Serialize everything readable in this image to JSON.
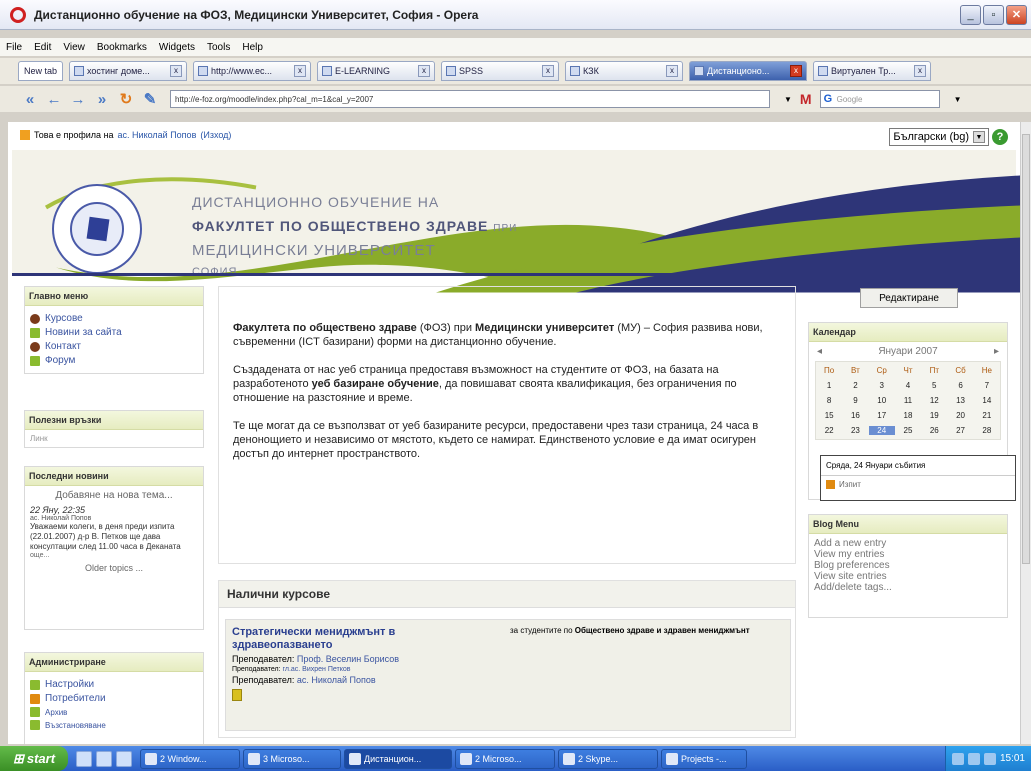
{
  "window": {
    "title": "Дистанционно обучение на ФОЗ, Медицински Университет, София - Opera",
    "min": "_",
    "max": "▫",
    "close": "✕"
  },
  "menu": [
    "File",
    "Edit",
    "View",
    "Bookmarks",
    "Widgets",
    "Tools",
    "Help"
  ],
  "tabs": {
    "new": "New tab",
    "items": [
      {
        "label": "хостинг доме..."
      },
      {
        "label": "http://www.ec..."
      },
      {
        "label": "E-LEARNING"
      },
      {
        "label": "SPSS"
      },
      {
        "label": "КЗК"
      },
      {
        "label": "Дистанционо...",
        "active": true
      },
      {
        "label": "Виртуален Тр..."
      }
    ]
  },
  "address": {
    "url": "http://e-foz.org/moodle/index.php?cal_m=1&cal_y=2007",
    "search_placeholder": "Google"
  },
  "page": {
    "login_prefix": "Това е профила на",
    "login_user": "ас. Николай Попов",
    "login_exit": "(Изход)",
    "language": "Български (bg)",
    "banner": {
      "l1": "ДИСТАНЦИОННО ОБУЧЕНИЕ НА",
      "l2": "ФАКУЛТЕТ ПО ОБЩЕСТВЕНО ЗДРАВЕ",
      "l2b": "ПРИ",
      "l3": "МЕДИЦИНСКИ УНИВЕРСИТЕТ",
      "l4": "СОФИЯ"
    },
    "main_menu": {
      "title": "Главно меню",
      "items": [
        "Курсове",
        "Новини за сайта",
        "Контакт",
        "Форум"
      ]
    },
    "search_forums": {
      "title": "Полезни връзки",
      "sub": "Линк"
    },
    "news": {
      "title": "Последни новини",
      "add": "Добавяне на нова тема...",
      "date": "22 Яну, 22:35",
      "author": "ас. Николай Попов",
      "text": "Уважаеми колеги, в деня преди изпита (22.01.2007) д-р В. Петков ще дава консултации след 11.00 часа в Деканата",
      "more": "още...",
      "older": "Older topics ..."
    },
    "admin": {
      "title": "Администриране",
      "items": [
        "Настройки",
        "Потребители",
        "Архив",
        "Възстановяване"
      ]
    },
    "intro": {
      "p1_b1": "Факултета по обществено здраве",
      "p1_a": " (ФОЗ) при ",
      "p1_b2": "Медицински университет",
      "p1_c": " (МУ) – София развива нови, съвременни (ICT базирани) форми на дистанционно обучение.",
      "p2_a": "Създадената от нас уеб страница предоставя възможност на студентите от ФОЗ, на базата на разработеното ",
      "p2_b": "уеб базиране обучение",
      "p2_c": ", да повишават своята квалификация, без ограничения по отношение на разстояние и време.",
      "p3": "Те ще могат да се възползват от уеб базираните ресурси, предоставени чрез тази страница, 24 часа в денонощието и независимо от мястото, където се намират. Единственото условие е да имат осигурен достъп до интернет пространството."
    },
    "courses": {
      "title": "Налични курсове",
      "name": "Стратегически мениджмънт в здравеопазването",
      "desc_a": "за студентите по ",
      "desc_b": "Обществено здраве и здравен мениджмънт",
      "t1_label": "Преподавател: ",
      "t1": "Проф. Веселин Борисов",
      "t2_label": "Преподавател: ",
      "t2": "гл.ас. Вихрен Петков",
      "t3_label": "Преподавател: ",
      "t3": "ас. Николай Попов"
    },
    "edit": "Редактиране",
    "calendar": {
      "title": "Календар",
      "month": "Януари 2007",
      "days": [
        "По",
        "Вт",
        "Ср",
        "Чт",
        "Пт",
        "Сб",
        "Не"
      ],
      "dates": [
        "1",
        "2",
        "3",
        "4",
        "5",
        "6",
        "7",
        "8",
        "9",
        "10",
        "11",
        "12",
        "13",
        "14",
        "15",
        "16",
        "17",
        "18",
        "19",
        "20",
        "21",
        "22",
        "23",
        "24",
        "25",
        "26",
        "27",
        "28"
      ],
      "today": "24",
      "tip": "Сряда, 24 Януари събития",
      "tip_event": "Изпит"
    },
    "blog": {
      "title": "Blog Menu",
      "items": [
        "Add a new entry",
        "View my entries",
        "Blog preferences",
        "View site entries",
        "Add/delete tags..."
      ]
    }
  },
  "taskbar": {
    "start": "start",
    "items": [
      "2 Window...",
      "3 Microso...",
      "Дистанцион...",
      "2 Microso...",
      "2 Skype...",
      "Projects -..."
    ],
    "active": "Дистанцион...",
    "clock": "15:01"
  }
}
